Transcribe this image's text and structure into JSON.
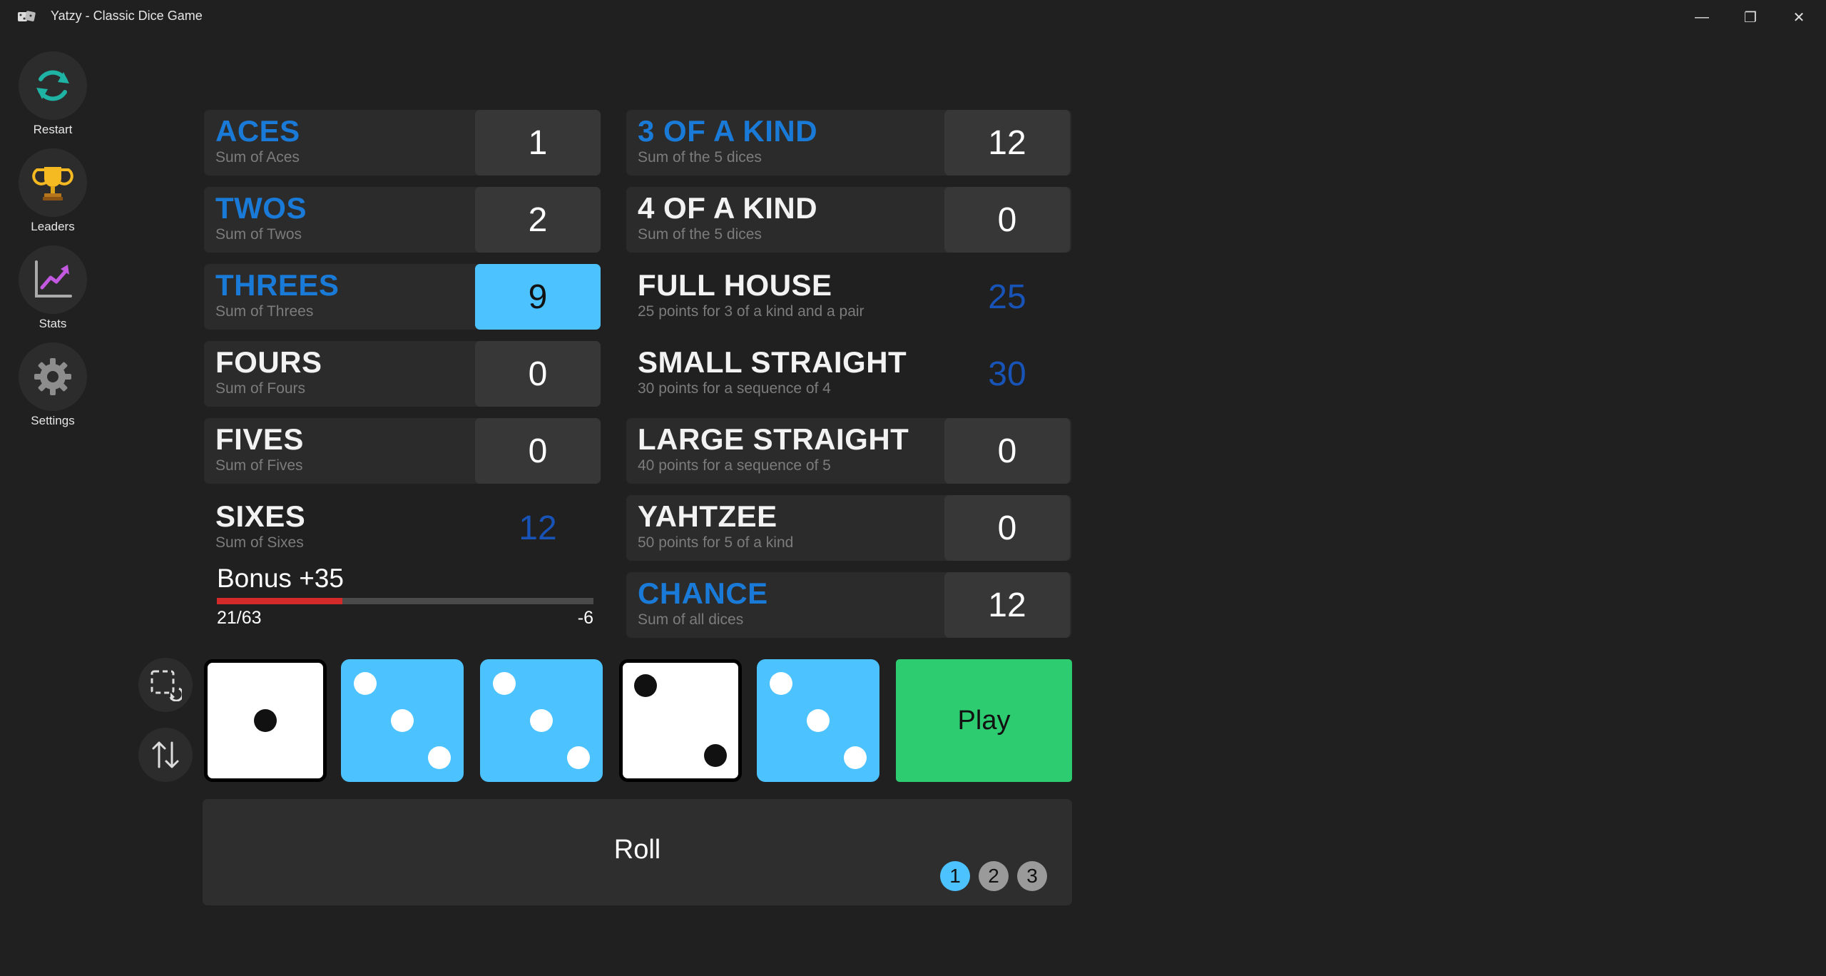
{
  "window": {
    "title": "Yatzy - Classic Dice Game",
    "minimize_glyph": "—",
    "maximize_glyph": "❐",
    "close_glyph": "✕"
  },
  "sidebar": {
    "items": [
      {
        "label": "Restart",
        "icon": "restart-icon"
      },
      {
        "label": "Leaders",
        "icon": "trophy-icon"
      },
      {
        "label": "Stats",
        "icon": "chart-icon"
      },
      {
        "label": "Settings",
        "icon": "gear-icon"
      }
    ]
  },
  "upper": [
    {
      "name": "ACES",
      "desc": "Sum of Aces",
      "score": "1",
      "state": "scored",
      "highlight": true
    },
    {
      "name": "TWOS",
      "desc": "Sum of Twos",
      "score": "2",
      "state": "scored",
      "highlight": true
    },
    {
      "name": "THREES",
      "desc": "Sum of Threes",
      "score": "9",
      "state": "selected",
      "highlight": true
    },
    {
      "name": "FOURS",
      "desc": "Sum of Fours",
      "score": "0",
      "state": "scored",
      "highlight": false
    },
    {
      "name": "FIVES",
      "desc": "Sum of Fives",
      "score": "0",
      "state": "scored",
      "highlight": false
    },
    {
      "name": "SIXES",
      "desc": "Sum of Sixes",
      "score": "12",
      "state": "potential",
      "highlight": false
    }
  ],
  "lower": [
    {
      "name": "3 OF A KIND",
      "desc": "Sum of the 5 dices",
      "score": "12",
      "state": "scored",
      "highlight": true
    },
    {
      "name": "4 OF A KIND",
      "desc": "Sum of the 5 dices",
      "score": "0",
      "state": "scored",
      "highlight": false
    },
    {
      "name": "FULL HOUSE",
      "desc": "25 points for 3 of a kind and a pair",
      "score": "25",
      "state": "potential",
      "highlight": false
    },
    {
      "name": "SMALL STRAIGHT",
      "desc": "30 points for a sequence of 4",
      "score": "30",
      "state": "potential",
      "highlight": false
    },
    {
      "name": "LARGE STRAIGHT",
      "desc": "40 points for a sequence of 5",
      "score": "0",
      "state": "scored",
      "highlight": false
    },
    {
      "name": "YAHTZEE",
      "desc": "50 points for 5 of a kind",
      "score": "0",
      "state": "scored",
      "highlight": false
    },
    {
      "name": "CHANCE",
      "desc": "Sum of all dices",
      "score": "12",
      "state": "scored",
      "highlight": true
    }
  ],
  "bonus": {
    "label": "Bonus +35",
    "progress_text": "21/63",
    "remaining": "-6",
    "progress_fraction": 0.333
  },
  "tools": {
    "select_icon": "select-reset-icon",
    "sort_icon": "sort-icon"
  },
  "dice": [
    {
      "value": 1,
      "held": false
    },
    {
      "value": 3,
      "held": true
    },
    {
      "value": 3,
      "held": true
    },
    {
      "value": 2,
      "held": false
    },
    {
      "value": 3,
      "held": true
    }
  ],
  "play_label": "Play",
  "roll": {
    "label": "Roll",
    "counters": [
      "1",
      "2",
      "3"
    ],
    "current": 1
  },
  "colors": {
    "accent": "#4cc2ff",
    "category_highlight": "#1a7ad8",
    "potential_score": "#1854b8",
    "play": "#2ecc71",
    "bonus_fill": "#d42a2a"
  }
}
